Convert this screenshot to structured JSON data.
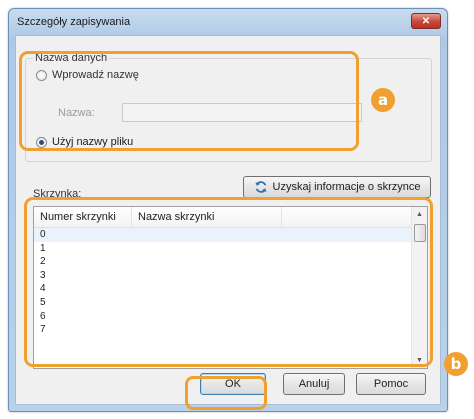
{
  "window": {
    "title": "Szczegóły zapisywania",
    "close_glyph": "✕"
  },
  "data_name_group": {
    "label": "Nazwa danych",
    "option_enter_name": "Wprowadź nazwę",
    "name_field_label": "Nazwa:",
    "name_field_value": "",
    "option_use_filename": "Użyj nazwy pliku",
    "selected_option": "use_filename"
  },
  "get_box_info_button": "Uzyskaj informacje o skrzynce",
  "box": {
    "label": "Skrzynka:",
    "columns": [
      "Numer skrzynki",
      "Nazwa skrzynki"
    ],
    "rows": [
      "0",
      "1",
      "2",
      "3",
      "4",
      "5",
      "6",
      "7"
    ],
    "selected_row": "0"
  },
  "buttons": {
    "ok": "OK",
    "cancel": "Anuluj",
    "help": "Pomoc"
  },
  "callouts": {
    "a": "a",
    "b": "b"
  },
  "colors": {
    "callout": "#f0a030",
    "title_gradient_top": "#c8dcf0",
    "close_button": "#c9473a"
  }
}
